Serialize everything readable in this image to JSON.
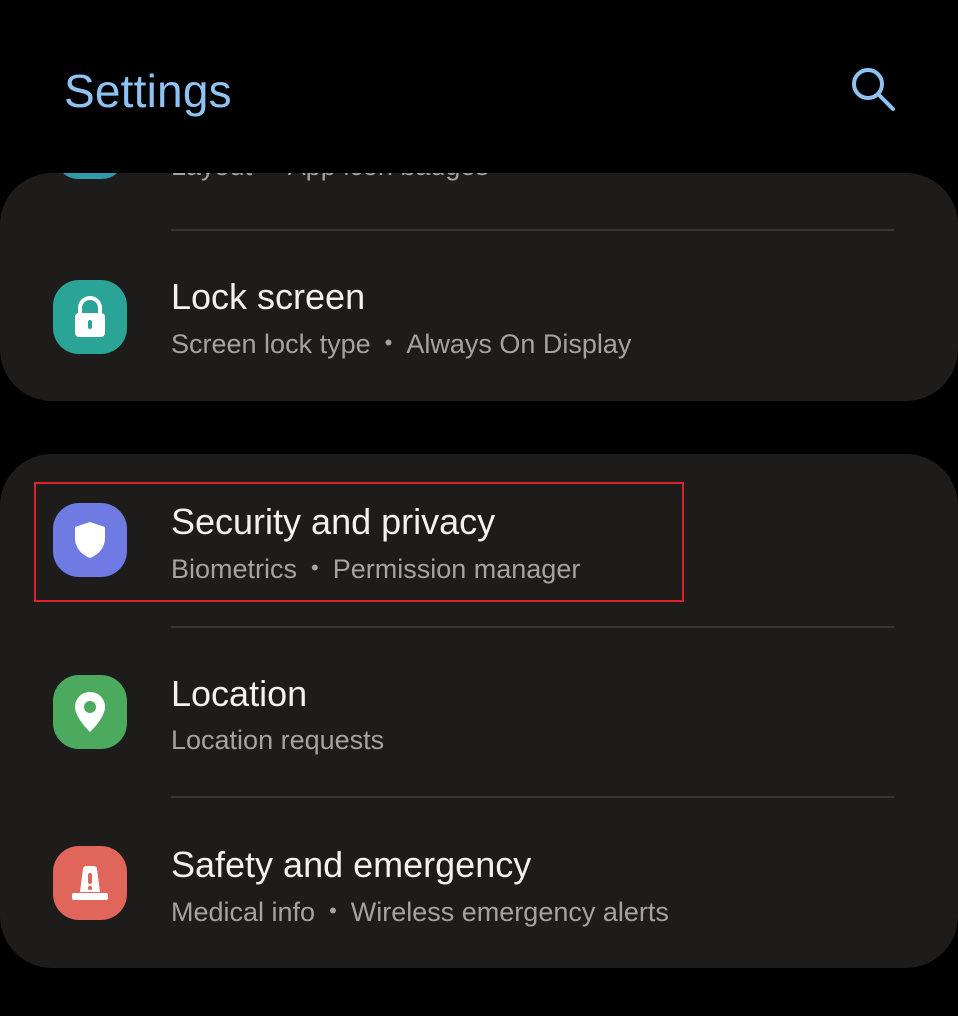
{
  "header": {
    "title": "Settings",
    "search_icon": "search-icon"
  },
  "sections": {
    "top_card": {
      "peek_item": {
        "subtitle_parts": [
          "Layout",
          "App icon badges"
        ],
        "icon_color": "#2e99a8"
      },
      "lock_screen": {
        "title": "Lock screen",
        "subtitle_parts": [
          "Screen lock type",
          "Always On Display"
        ],
        "icon": "lock-icon",
        "icon_color": "#2aa497"
      }
    },
    "bottom_card": {
      "security": {
        "title": "Security and privacy",
        "subtitle_parts": [
          "Biometrics",
          "Permission manager"
        ],
        "icon": "shield-icon",
        "icon_color": "#6f7ae3",
        "highlighted": true
      },
      "location": {
        "title": "Location",
        "subtitle_parts": [
          "Location requests"
        ],
        "icon": "location-pin-icon",
        "icon_color": "#4caa5e"
      },
      "safety": {
        "title": "Safety and emergency",
        "subtitle_parts": [
          "Medical info",
          "Wireless emergency alerts"
        ],
        "icon": "siren-icon",
        "icon_color": "#e0655a"
      }
    }
  },
  "separator": "•",
  "colors": {
    "background": "#000000",
    "card": "#1e1c1b",
    "title_accent": "#8ec2f2",
    "highlight_border": "#e0212b"
  }
}
